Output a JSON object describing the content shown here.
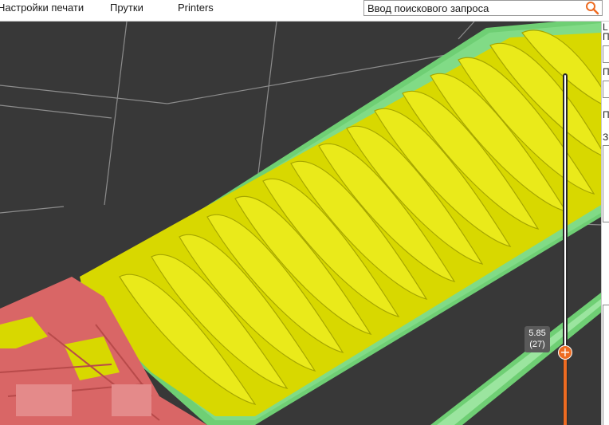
{
  "top_tabs": [
    {
      "label": "Настройки печати"
    },
    {
      "label": "Прутки"
    },
    {
      "label": "Printers"
    }
  ],
  "search": {
    "placeholder": "Ввод поискового запроса",
    "icon": "search-icon"
  },
  "layer_slider": {
    "height_value": "5.85",
    "layer_value": "(27)",
    "accent_color": "#ed6b21"
  },
  "side_panel": {
    "glyphs": [
      "L",
      "П",
      "П",
      "П",
      "З"
    ]
  },
  "colors": {
    "background": "#383838",
    "grid": "#8a8a8a",
    "infill": "#d9d900",
    "perimeter": "#79d97e",
    "wall": "#d66363"
  }
}
